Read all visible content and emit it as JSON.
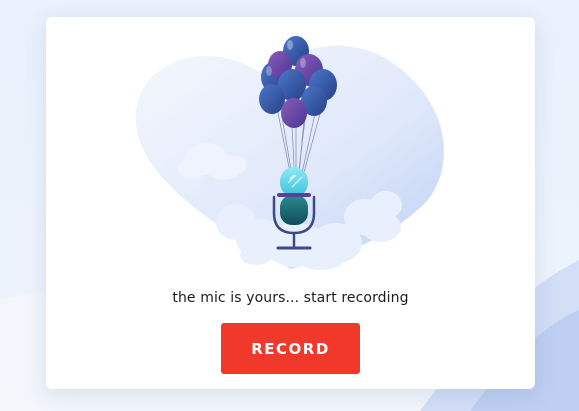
{
  "card": {
    "prompt_text": "the mic is yours... start recording",
    "record_label": "RECORD"
  },
  "illustration": {
    "subject": "microphone-lifted-by-balloons",
    "icons": [
      "balloons-icon",
      "microphone-icon",
      "cloud-icon"
    ]
  },
  "colors": {
    "background": "#eaf1fc",
    "card": "#ffffff",
    "button": "#f1392b",
    "button_text": "#ffffff",
    "text": "#1c1c1c",
    "balloon_blue": "#3b5ba8",
    "balloon_purple": "#6a4fa0",
    "mic_cyan": "#5fd3e8",
    "mic_teal": "#1f6f78"
  }
}
